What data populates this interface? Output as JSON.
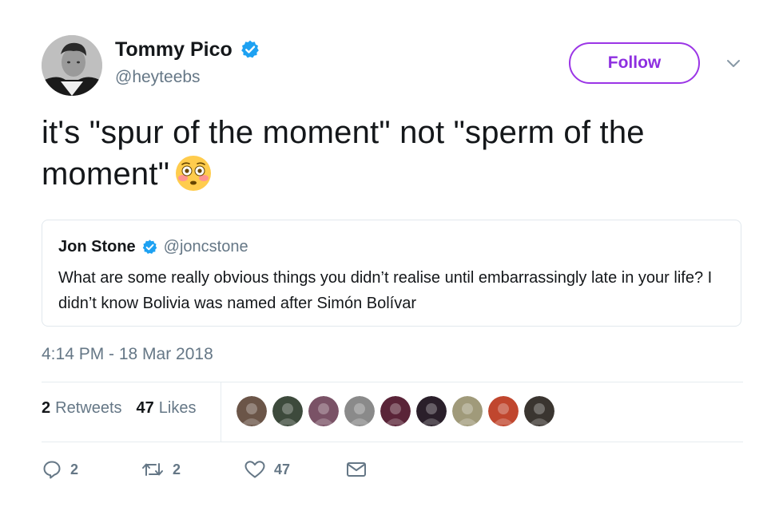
{
  "author": {
    "name": "Tommy Pico",
    "handle": "@heyteebs",
    "verified": true
  },
  "follow_button": {
    "label": "Follow"
  },
  "tweet": {
    "text_line1": "it's \"spur of the moment\" not \"sperm of the",
    "text_line2": "moment\"",
    "emoji": "flushed-face"
  },
  "quoted_tweet": {
    "name": "Jon Stone",
    "handle": "@joncstone",
    "verified": true,
    "text": "What are some really obvious things you didn’t realise until embarrassingly late in your life? I didn’t know Bolivia was named after Simón Bolívar"
  },
  "timestamp": "4:14 PM - 18 Mar 2018",
  "stats": {
    "retweets_count": "2",
    "retweets_label": "Retweets",
    "likes_count": "47",
    "likes_label": "Likes"
  },
  "likers": [
    {
      "color": "#6b5548"
    },
    {
      "color": "#3d4a3c"
    },
    {
      "color": "#7a5266"
    },
    {
      "color": "#8a8a8a"
    },
    {
      "color": "#5a2438"
    },
    {
      "color": "#2a1f2a"
    },
    {
      "color": "#a09a7a"
    },
    {
      "color": "#c0462e"
    },
    {
      "color": "#3a3530"
    }
  ],
  "actions": {
    "replies": "2",
    "retweets": "2",
    "likes": "47"
  },
  "colors": {
    "accent_purple": "#9b35e6",
    "verified_blue": "#1da1f2",
    "muted_gray": "#657786"
  }
}
